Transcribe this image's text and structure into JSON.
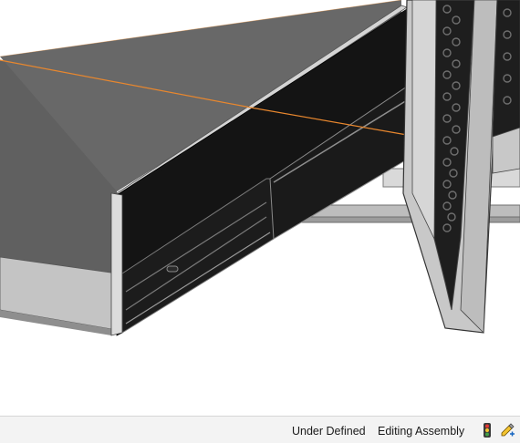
{
  "statusbar": {
    "state_label": "Under Defined",
    "mode_label": "Editing Assembly",
    "icons": [
      "traffic-light-icon",
      "rebuild-pen-icon"
    ]
  },
  "colors": {
    "background": "#ffffff",
    "chassis_top": "#5e5e5e",
    "chassis_side": "#151515",
    "frame_grey": "#c8c8c8",
    "edge_highlight": "#e8872e"
  }
}
